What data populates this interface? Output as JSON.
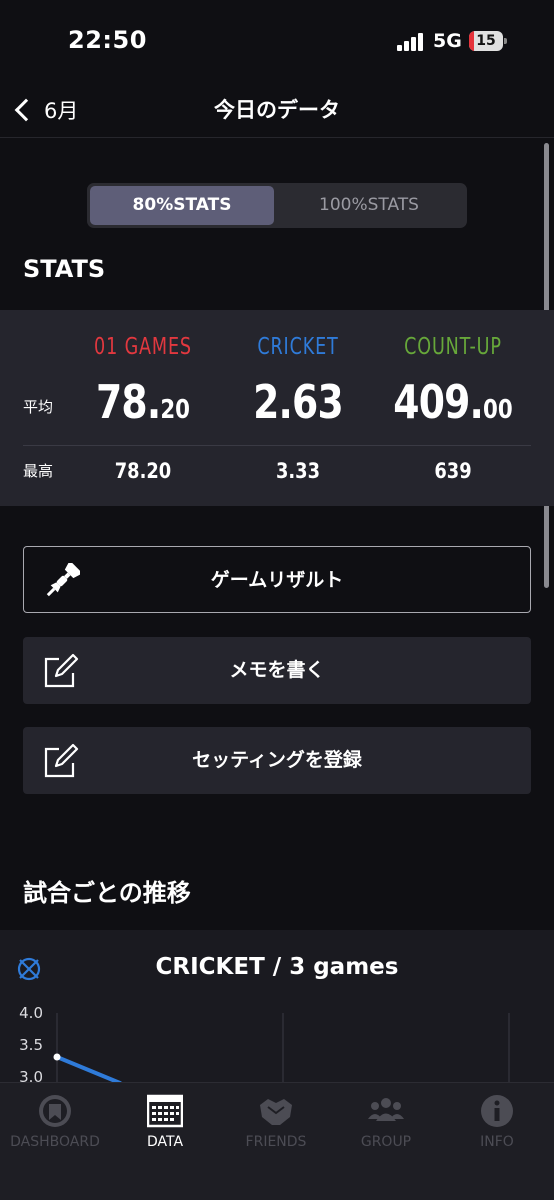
{
  "status_bar": {
    "time": "22:50",
    "network": "5G",
    "battery": "15",
    "battery_level": 0.15
  },
  "nav": {
    "back_label": "6月",
    "title": "今日のデータ"
  },
  "segmented": {
    "option1": "80%STATS",
    "option2": "100%STATS",
    "selected": "80%STATS"
  },
  "stats": {
    "heading": "STATS",
    "row_avg_label": "平均",
    "row_max_label": "最高",
    "columns": [
      {
        "name": "01 GAMES",
        "color": "#e2383f",
        "avg_int": "78.",
        "avg_dec": "20",
        "max": "78.20"
      },
      {
        "name": "CRICKET",
        "color": "#2f7bd9",
        "avg_int": "2.63",
        "avg_dec": "",
        "max": "3.33"
      },
      {
        "name": "COUNT-UP",
        "color": "#67a83a",
        "avg_int": "409.",
        "avg_dec": "00",
        "max": "639"
      }
    ]
  },
  "actions": {
    "game_result": "ゲームリザルト",
    "write_memo": "メモを書く",
    "register_setting": "セッティングを登録"
  },
  "trend": {
    "heading": "試合ごとの推移",
    "chart_title": "CRICKET / 3 games"
  },
  "chart_data": {
    "type": "line",
    "title": "CRICKET / 3 games",
    "y_ticks": [
      "4.0",
      "3.5",
      "3.0"
    ],
    "series": [
      {
        "color": "#2f7bd9",
        "values": [
          3.33
        ]
      }
    ]
  },
  "tabs": [
    {
      "label": "DASHBOARD",
      "icon": "dashboard-icon",
      "active": false
    },
    {
      "label": "DATA",
      "icon": "data-icon",
      "active": true
    },
    {
      "label": "FRIENDS",
      "icon": "friends-icon",
      "active": false
    },
    {
      "label": "GROUP",
      "icon": "group-icon",
      "active": false
    },
    {
      "label": "INFO",
      "icon": "info-icon",
      "active": false
    }
  ]
}
